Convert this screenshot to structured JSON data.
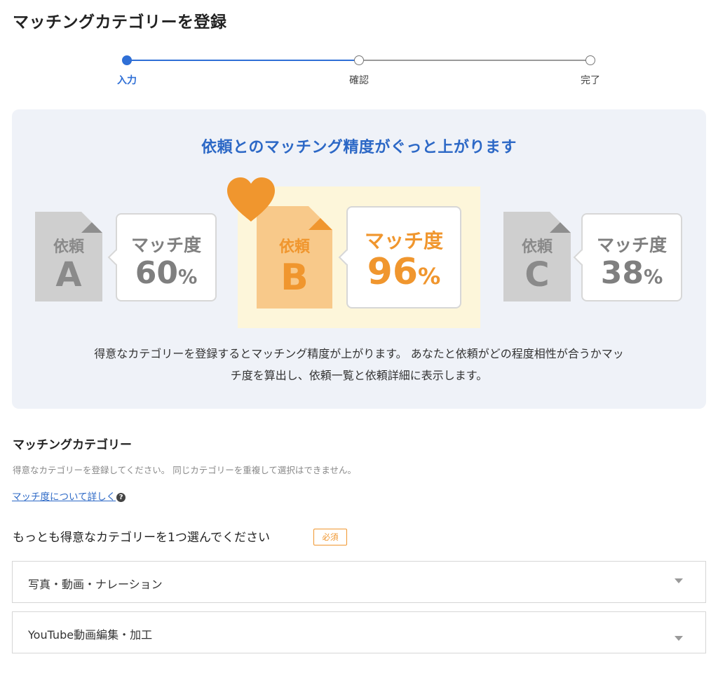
{
  "page": {
    "title": "マッチングカテゴリーを登録"
  },
  "stepper": {
    "steps": [
      {
        "label": "入力",
        "active": true
      },
      {
        "label": "確認",
        "active": false
      },
      {
        "label": "完了",
        "active": false
      }
    ],
    "accent_color": "#2f6fd6"
  },
  "info_panel": {
    "heading": "依頼とのマッチング精度がぐっと上がります",
    "cards": [
      {
        "doc_word": "依頼",
        "doc_letter": "A",
        "match_label": "マッチ度",
        "match_value": "60",
        "match_unit": "%",
        "highlighted": false
      },
      {
        "doc_word": "依頼",
        "doc_letter": "B",
        "match_label": "マッチ度",
        "match_value": "96",
        "match_unit": "%",
        "highlighted": true
      },
      {
        "doc_word": "依頼",
        "doc_letter": "C",
        "match_label": "マッチ度",
        "match_value": "38",
        "match_unit": "%",
        "highlighted": false
      }
    ],
    "highlight_icon": "heart-icon",
    "highlight_color": "#f0962e",
    "description_line1": "得意なカテゴリーを登録するとマッチング精度が上がります。 あなたと依頼がどの程度相性が合うかマッ",
    "description_line2": "チ度を算出し、依頼一覧と依頼詳細に表示します。"
  },
  "form": {
    "section_title": "マッチングカテゴリー",
    "section_note": "得意なカテゴリーを登録してください。 同じカテゴリーを重複して選択はできません。",
    "help_link": "マッチ度について詳しく",
    "help_icon": "question-circle-icon",
    "question": "もっとも得意なカテゴリーを1つ選んでください",
    "required_badge": "必須",
    "selects": [
      {
        "value": "写真・動画・ナレーション"
      },
      {
        "value": "YouTube動画編集・加工"
      }
    ]
  }
}
